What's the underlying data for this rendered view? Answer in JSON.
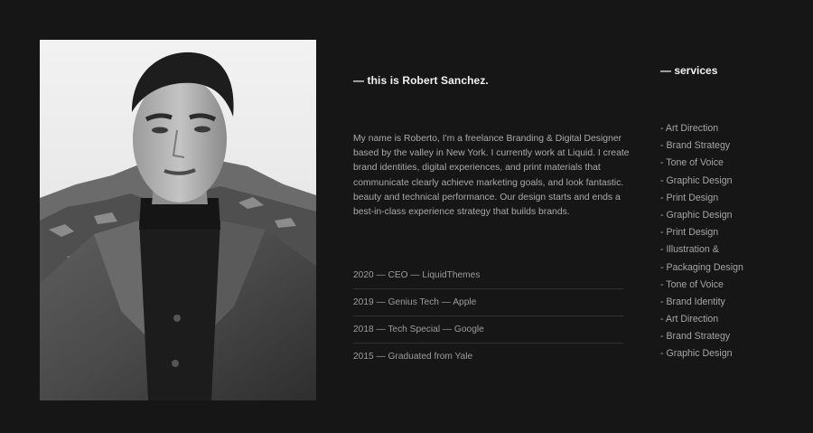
{
  "intro": {
    "heading": "— this is Robert Sanchez.",
    "bio": "My name is Roberto, I'm a freelance Branding & Digital Designer based by the valley in New York. I currently work at Liquid. I create brand identities, digital experiences, and print materials that communicate clearly achieve marketing goals, and look fantastic. beauty and technical performance. Our design starts and ends a best-in-class experience strategy that builds brands."
  },
  "timeline": [
    "2020 — CEO — LiquidThemes",
    "2019 — Genius Tech — Apple",
    "2018 — Tech Special — Google",
    "2015 — Graduated from Yale"
  ],
  "services": {
    "heading": "— services",
    "items": [
      "- Art Direction",
      "- Brand Strategy",
      "- Tone of Voice",
      "- Graphic Design",
      "- Print Design",
      "- Graphic Design",
      "- Print Design",
      "- Illustration &",
      "- Packaging Design",
      "- Tone of Voice",
      "- Brand Identity",
      "- Art Direction",
      "- Brand Strategy",
      "- Graphic Design"
    ]
  },
  "colors": {
    "background": "#161616",
    "heading": "#f2f2f2",
    "text": "#aaaaaa"
  }
}
